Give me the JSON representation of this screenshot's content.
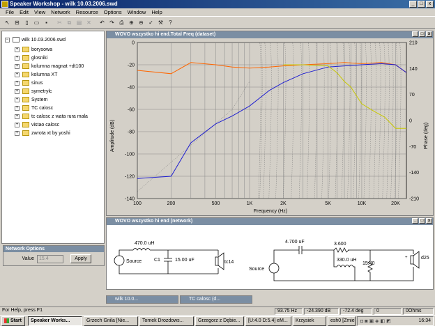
{
  "window": {
    "title": "Speaker Workshop - wilk 10.03.2006.swd",
    "min": "_",
    "max": "□",
    "close": "x"
  },
  "menu": [
    "File",
    "Edit",
    "View",
    "Network",
    "Resource",
    "Options",
    "Window",
    "Help"
  ],
  "toolbar_icons": [
    "select-icon",
    "tree-icon",
    "new-icon",
    "open-icon",
    "save-icon",
    "cut-icon",
    "copy-icon",
    "paste-icon",
    "delete-icon",
    "undo-icon",
    "redo-icon",
    "print-icon",
    "zoom-in-icon",
    "zoom-out-icon",
    "check-icon",
    "wrench-icon",
    "help-icon"
  ],
  "tree": {
    "root": "wilk 10.03.2006.swd",
    "items": [
      "borysowa",
      "glosniki",
      "kolumna magnat +dt100",
      "kolumna XT",
      "sinus",
      "symetrylc",
      "System",
      "TC calosc",
      "tc calosc z wata rura mala",
      "vistao calosc",
      "zwrota xt by yoshi"
    ]
  },
  "net_options": {
    "title": "Network Options",
    "label": "Value",
    "value": "15.4",
    "apply": "Apply"
  },
  "chart_window": {
    "title": "WOVO wszystko hi end.Total Freq (dataset)"
  },
  "chart_data": {
    "type": "line",
    "xlabel": "Frequency (Hz)",
    "ylabel": "Amplitude (dB)",
    "y2label": "Phase (deg)",
    "xscale": "log",
    "xlim": [
      100,
      25000
    ],
    "ylim": [
      -140,
      0
    ],
    "y2lim": [
      -210,
      210
    ],
    "xticks": [
      "100",
      "200",
      "500",
      "1K",
      "2K",
      "5K",
      "10K",
      "20K"
    ],
    "yticks": [
      "0",
      "-20",
      "-40",
      "-60",
      "-80",
      "-100",
      "-120",
      "-140"
    ],
    "y2ticks": [
      "210",
      "140",
      "70",
      "0",
      "-70",
      "-140",
      "-210"
    ],
    "grid": true,
    "series": [
      {
        "color": "#ff6600",
        "x": [
          100,
          200,
          300,
          500,
          700,
          1000,
          1500,
          2000,
          3000,
          5000,
          7000,
          10000,
          15000,
          20000,
          25000
        ],
        "y": [
          -25,
          -28,
          -18,
          -20,
          -22,
          -23,
          -22,
          -21,
          -20,
          -19,
          -18,
          -19,
          -18,
          -20,
          -27
        ]
      },
      {
        "color": "#2020d0",
        "x": [
          100,
          200,
          300,
          500,
          700,
          1000,
          1500,
          2000,
          3000,
          5000,
          7000,
          10000,
          15000,
          20000,
          25000
        ],
        "y": [
          -122,
          -120,
          -90,
          -73,
          -66,
          -57,
          -43,
          -36,
          -28,
          -22,
          -21,
          -20,
          -19,
          -20,
          -27
        ]
      },
      {
        "color": "#c8c800",
        "x": [
          2000,
          3000,
          5000,
          6000,
          7000,
          8000,
          10000,
          13000,
          16000,
          20000,
          25000
        ],
        "y": [
          -20,
          -20,
          -21,
          -27,
          -35,
          -40,
          -55,
          -62,
          -67,
          -77,
          -77
        ]
      }
    ]
  },
  "network_window": {
    "title": "WOVO wszystko hi end (network)",
    "left": {
      "inductor": "470.0 uH",
      "capacitor_name": "C1",
      "capacitor": "15.00 uF",
      "source": "Source",
      "driver": "tc14"
    },
    "right": {
      "capacitor": "4.700 uF",
      "resistor1": "3.600",
      "inductor": "330.0 uH",
      "resistor2": "15.40",
      "source": "Source",
      "driver": "d25"
    }
  },
  "min_windows": [
    {
      "title": "wilk 10.0..."
    },
    {
      "title": "TC calosc (d..."
    }
  ],
  "status": {
    "help": "For Help, press F1",
    "freq": "93.75 Hz",
    "db": "-24.390 dB",
    "deg": "-72.4 deg",
    "zero": "0",
    "ohms": "0Ohms"
  },
  "taskbar": {
    "start": "Start",
    "tasks": [
      "Speaker Works...",
      "Grzech Gnila [Nie...",
      "Tomek Drozdows...",
      "Grzegorz z Dębie...",
      "[U:4.0 D:5.4] eM...",
      "Krzysiek",
      "esh0 [Zmienia..."
    ],
    "clock": "16:34"
  }
}
